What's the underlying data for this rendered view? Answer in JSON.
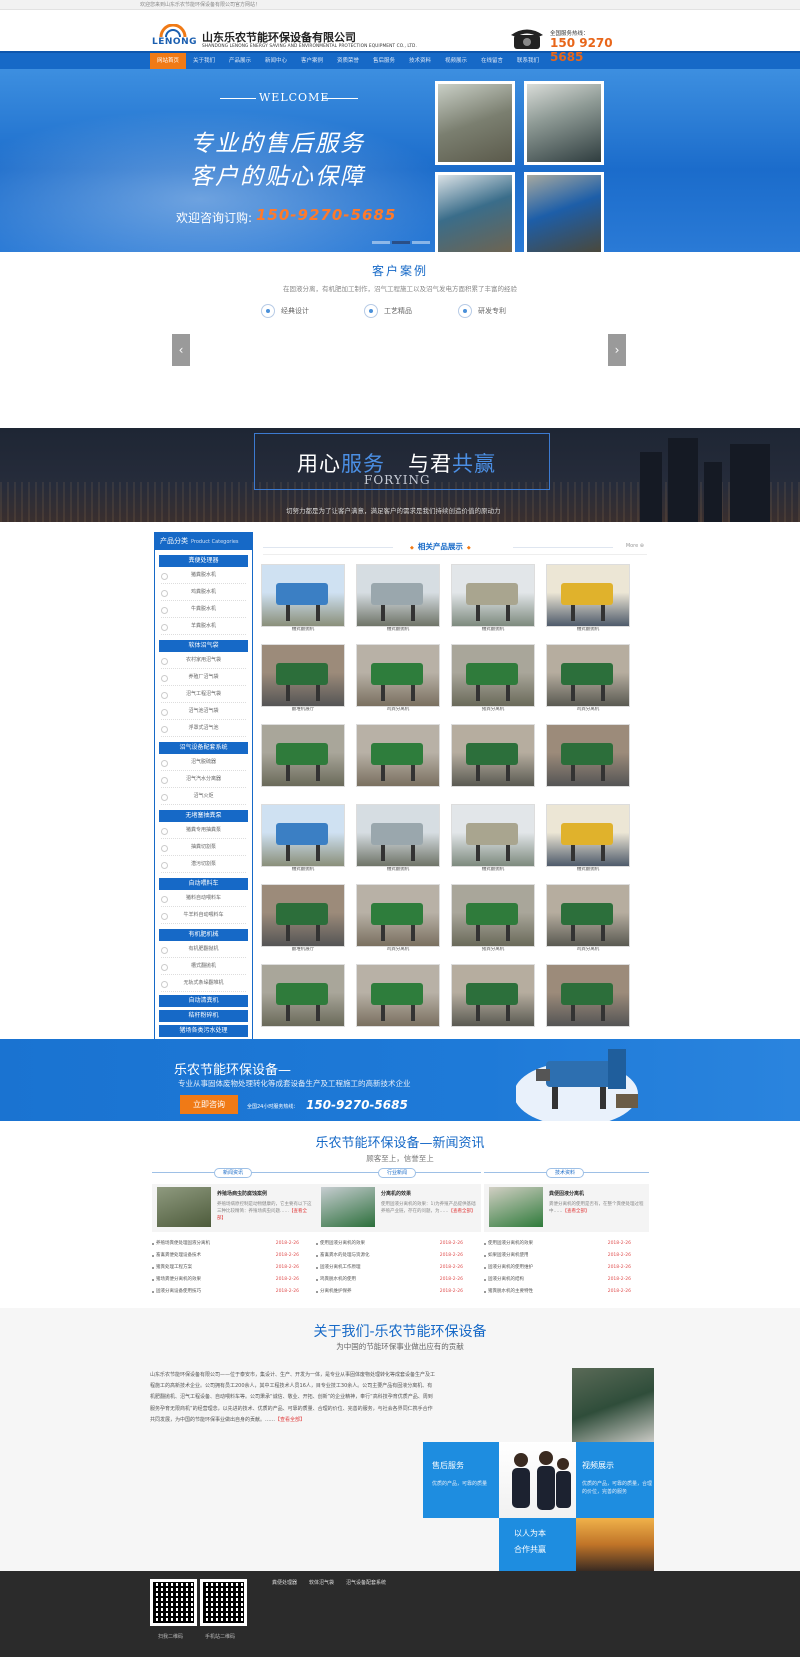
{
  "topbar": {
    "text": "欢迎您来到山东乐农节能环保设备有限公司官方网站！"
  },
  "header": {
    "logo_text": "LENONG",
    "company_name": "山东乐农节能环保设备有限公司",
    "company_en": "SHANDONG LENONG ENERGY SAVING AND ENVIRONMENTAL PROTECTION EQUIPMENT CO., LTD.",
    "hotline_label": "全国服务热线：",
    "hotline": "150 9270 5685"
  },
  "nav": {
    "items": [
      {
        "label": "网站首页"
      },
      {
        "label": "关于我们"
      },
      {
        "label": "产品展示"
      },
      {
        "label": "新闻中心"
      },
      {
        "label": "客户案例"
      },
      {
        "label": "资质荣誉"
      },
      {
        "label": "售后服务"
      },
      {
        "label": "技术资料"
      },
      {
        "label": "视频展示"
      },
      {
        "label": "在线留言"
      },
      {
        "label": "联系我们"
      }
    ]
  },
  "banner": {
    "welcome": "WELCOME",
    "slogan1": "专业的售后服务",
    "slogan2": "客户的贴心保障",
    "consult": "欢迎咨询订购:",
    "phone": "150-9270-5685"
  },
  "cases": {
    "title": "客户案例",
    "subtitle": "在固液分离，有机肥加工制作，沼气工程施工以及沼气发电方面积累了丰富的经验",
    "features": [
      {
        "label": "经典设计"
      },
      {
        "label": "工艺精品"
      },
      {
        "label": "研发专利"
      }
    ]
  },
  "dark_banner": {
    "title_a": "用心",
    "title_b": "服务",
    "title_c": "与君",
    "title_d": "共赢",
    "en": "FORYING",
    "line": "切努力都是为了让客户满意，满足客户的需求是我们持续创造价值的原动力"
  },
  "products": {
    "cat_title": "产品分类",
    "cat_title_en": "Product Categories",
    "groups": [
      {
        "name": "粪便处理器",
        "items": [
          "猪粪脱水机",
          "鸡粪脱水机",
          "牛粪脱水机",
          "羊粪脱水机"
        ]
      },
      {
        "name": "软体沼气袋",
        "items": [
          "农村家用沼气袋",
          "养殖厂沼气袋",
          "沼气工程沼气袋",
          "沼气池沼气袋",
          "浮罩式沼气池"
        ]
      },
      {
        "name": "沼气设备配套系统",
        "items": [
          "沼气脱硫器",
          "沼气汽水分离器",
          "沼气火炬"
        ]
      },
      {
        "name": "无堵塞抽粪泵",
        "items": [
          "猪粪专用抽粪泵",
          "抽粪切割泵",
          "潜污切割泵"
        ]
      },
      {
        "name": "自动喂料车",
        "items": [
          "猪料自动喂料车",
          "牛羊料自动喂料车"
        ]
      },
      {
        "name": "有机肥机械",
        "items": [
          "有机肥翻抛机",
          "槽式翻抛机",
          "无轨式条垛翻堆机"
        ]
      },
      {
        "name": "自动清粪机",
        "items": []
      },
      {
        "name": "秸秆粉碎机",
        "items": []
      },
      {
        "name": "猪场各类污水处理",
        "items": []
      }
    ],
    "related_title": "相关产品展示",
    "more": "More",
    "cards": [
      {
        "caption": "槽式翻抛机"
      },
      {
        "caption": "槽式翻抛机"
      },
      {
        "caption": "槽式翻抛机"
      },
      {
        "caption": "槽式翻抛机"
      },
      {
        "caption": "翻堆机展厅"
      },
      {
        "caption": "鸡粪分离机"
      },
      {
        "caption": "猪粪分离机"
      },
      {
        "caption": "鸡粪分离机"
      },
      {
        "caption": ""
      },
      {
        "caption": ""
      },
      {
        "caption": ""
      },
      {
        "caption": ""
      },
      {
        "caption": "槽式翻抛机"
      },
      {
        "caption": "槽式翻抛机"
      },
      {
        "caption": "槽式翻抛机"
      },
      {
        "caption": "槽式翻抛机"
      },
      {
        "caption": "翻堆机展厅"
      },
      {
        "caption": "鸡粪分离机"
      },
      {
        "caption": "猪粪分离机"
      },
      {
        "caption": "鸡粪分离机"
      },
      {
        "caption": ""
      },
      {
        "caption": ""
      },
      {
        "caption": ""
      },
      {
        "caption": ""
      }
    ]
  },
  "cta": {
    "headline": "乐农节能环保设备—",
    "sub": "专业从事固体废物处理转化等成套设备生产及工程施工的高新技术企业",
    "button": "立即咨询",
    "hotline_label": "全国24小时服务热线：",
    "phone": "150-9270-5685"
  },
  "news": {
    "title": "乐农节能环保设备—新闻资讯",
    "subtitle": "顾客至上，信誉至上",
    "columns": [
      {
        "tab": "新闻资讯",
        "feat_title": "养殖场病虫防腐蚀案例",
        "feat_desc": "养殖场病原控制是动物健康的，它主要有以下这三种比较精简：养殖场病虫问题……",
        "more": "【查看全部】",
        "items": [
          {
            "t": "养殖场粪便处理固液分离机",
            "d": "2018-2-26"
          },
          {
            "t": "畜禽粪便处理设备技术",
            "d": "2018-2-26"
          },
          {
            "t": "猪粪处理工程方案",
            "d": "2018-2-26"
          },
          {
            "t": "猪场粪便分离机的效果",
            "d": "2018-2-26"
          },
          {
            "t": "固液分离设备使用技巧",
            "d": "2018-2-26"
          }
        ]
      },
      {
        "tab": "行业新闻",
        "feat_title": "分离机的效果",
        "feat_desc": "使用固液分离机的效果：1)为养殖产品提供基础养殖产业链，存在的问题，为……",
        "more": "【查看全部】",
        "items": [
          {
            "t": "使用固液分离机的效果",
            "d": "2018-2-26"
          },
          {
            "t": "畜禽粪水的处理与资源化",
            "d": "2018-2-26"
          },
          {
            "t": "固液分离机工作原理",
            "d": "2018-2-26"
          },
          {
            "t": "鸡粪脱水机的使用",
            "d": "2018-2-26"
          },
          {
            "t": "分离机维护保养",
            "d": "2018-2-26"
          }
        ]
      },
      {
        "tab": "技术资料",
        "feat_title": "粪便固液分离机",
        "feat_desc": "粪便分离机的使用是否有，在整个粪便处理过程中……",
        "more": "【查看全部】",
        "items": [
          {
            "t": "使用固液分离机的效果",
            "d": "2018-2-26"
          },
          {
            "t": "如果固液分离机使用",
            "d": "2018-2-26"
          },
          {
            "t": "固液分离机的使用维护",
            "d": "2018-2-26"
          },
          {
            "t": "固液分离机的结构",
            "d": "2018-2-26"
          },
          {
            "t": "猪粪脱水机的主要特性",
            "d": "2018-2-26"
          }
        ]
      }
    ]
  },
  "about": {
    "title": "关于我们-乐农节能环保设备",
    "subtitle": "为中国的节能环保事业做出应有的贡献",
    "paragraph": "山东乐农节能环保设备有限公司——位于泰安市，集设计、生产、开发为一体，是专业从事固体废物处理转化等成套设备生产及工程施工的高新技术企业。公司拥有员工200余人，其中工程技术人员16人，目专业技工30余人。公司主要产品有固液分离机、有机肥翻抛机、沼气工程设备、自动喂料车等。公司秉承“诚信、敬业、开拓、创新”的企业精神，奉行“高科技孕育优质产品、周到服务孕育无限商机”的经营理念，以先进的技术、优质的产品、可靠的质量、合理的价位、完善的服务，与社会各界同仁携手合作共同发展，为中国的节能环保事业做出自身的贡献。……",
    "more": "【查看全部】",
    "tiles": [
      {
        "title": "售后服务",
        "desc": "优质的产品，可靠的质量"
      },
      {
        "title": "视频展示",
        "desc": "优质的产品，可靠的质量，合理的价位，完善的服务"
      },
      {
        "title": "以人为本",
        "title2": "合作共赢"
      }
    ]
  },
  "footer": {
    "links": [
      "粪便处理器",
      "软体沼气袋",
      "沼气设备配套系统"
    ],
    "qr": [
      {
        "caption": "扫我二维码"
      },
      {
        "caption": "手机站二维码"
      }
    ]
  }
}
